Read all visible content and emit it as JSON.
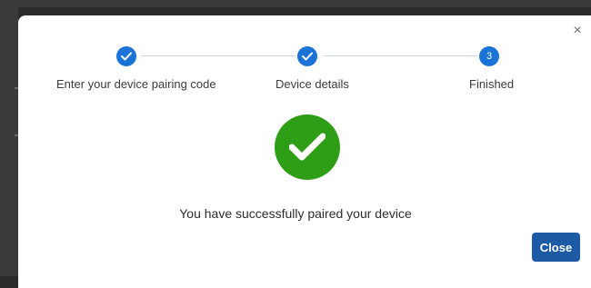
{
  "dialog": {
    "close_icon": "close-icon",
    "close_glyph": "×"
  },
  "stepper": {
    "steps": [
      {
        "label": "Enter your device pairing code",
        "status": "completed",
        "icon": "checkmark-icon"
      },
      {
        "label": "Device details",
        "status": "completed",
        "icon": "checkmark-icon"
      },
      {
        "label": "Finished",
        "status": "current",
        "number": "3"
      }
    ]
  },
  "result": {
    "icon": "success-checkmark-icon",
    "message": "You have successfully paired your device"
  },
  "footer": {
    "close_label": "Close"
  },
  "colors": {
    "step_accent": "#1a73d6",
    "success": "#2e9e16",
    "primary_button": "#1d5aa6"
  }
}
